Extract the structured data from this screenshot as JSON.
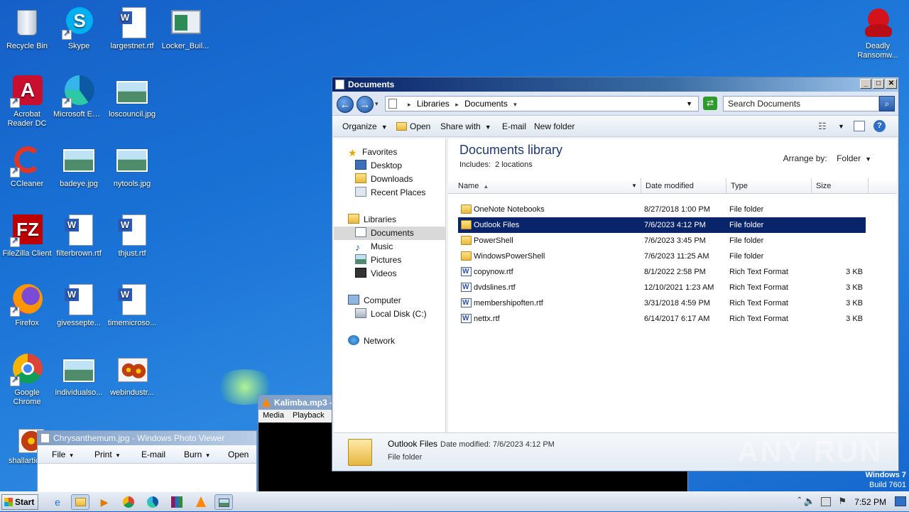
{
  "desktop": {
    "icons": [
      {
        "label": "Recycle Bin",
        "icon": "recycle-bin-icon"
      },
      {
        "label": "Skype",
        "icon": "skype-icon"
      },
      {
        "label": "largestnet.rtf",
        "icon": "rtf-document-icon"
      },
      {
        "label": "Locker_Buil...",
        "icon": "window-app-icon"
      },
      {
        "label": "Acrobat Reader DC",
        "icon": "acrobat-icon"
      },
      {
        "label": "Microsoft Edge",
        "icon": "edge-icon"
      },
      {
        "label": "loscouncil.jpg",
        "icon": "image-file-icon"
      },
      {
        "label": "CCleaner",
        "icon": "ccleaner-icon"
      },
      {
        "label": "badeye.jpg",
        "icon": "image-file-icon"
      },
      {
        "label": "nytools.jpg",
        "icon": "image-file-icon"
      },
      {
        "label": "FileZilla Client",
        "icon": "filezilla-icon"
      },
      {
        "label": "filterbrown.rtf",
        "icon": "rtf-document-icon"
      },
      {
        "label": "thjust.rtf",
        "icon": "rtf-document-icon"
      },
      {
        "label": "Firefox",
        "icon": "firefox-icon"
      },
      {
        "label": "givessepte...",
        "icon": "rtf-document-icon"
      },
      {
        "label": "timemicroso...",
        "icon": "rtf-document-icon"
      },
      {
        "label": "Google Chrome",
        "icon": "chrome-icon"
      },
      {
        "label": "individualso...",
        "icon": "image-file-icon"
      },
      {
        "label": "webindustr...",
        "icon": "flower-image-icon"
      },
      {
        "label": "shallarticle",
        "icon": "flower-image-icon"
      },
      {
        "label": "Deadly Ransomw...",
        "icon": "devil-icon"
      }
    ],
    "watermark": "Windows 7",
    "build": "Build 7601"
  },
  "explorer": {
    "title": "Documents",
    "breadcrumb": [
      "Libraries",
      "Documents"
    ],
    "search_placeholder": "Search Documents",
    "toolbar": {
      "organize": "Organize",
      "open": "Open",
      "share_with": "Share with",
      "email": "E-mail",
      "new_folder": "New folder"
    },
    "nav": {
      "favorites": "Favorites",
      "desktop": "Desktop",
      "downloads": "Downloads",
      "recent": "Recent Places",
      "libraries": "Libraries",
      "documents": "Documents",
      "music": "Music",
      "pictures": "Pictures",
      "videos": "Videos",
      "computer": "Computer",
      "local_disk": "Local Disk (C:)",
      "network": "Network"
    },
    "library_title": "Documents library",
    "includes_label": "Includes:",
    "includes_value": "2 locations",
    "arrange_label": "Arrange by:",
    "arrange_value": "Folder",
    "columns": {
      "name": "Name",
      "date": "Date modified",
      "type": "Type",
      "size": "Size"
    },
    "files": [
      {
        "name": "OneNote Notebooks",
        "date": "8/27/2018 1:00 PM",
        "type": "File folder",
        "size": "",
        "kind": "folder"
      },
      {
        "name": "Outlook Files",
        "date": "7/6/2023 4:12 PM",
        "type": "File folder",
        "size": "",
        "kind": "folder",
        "selected": true
      },
      {
        "name": "PowerShell",
        "date": "7/6/2023 3:45 PM",
        "type": "File folder",
        "size": "",
        "kind": "folder"
      },
      {
        "name": "WindowsPowerShell",
        "date": "7/6/2023 11:25 AM",
        "type": "File folder",
        "size": "",
        "kind": "folder"
      },
      {
        "name": "copynow.rtf",
        "date": "8/1/2022 2:58 PM",
        "type": "Rich Text Format",
        "size": "3 KB",
        "kind": "rtf"
      },
      {
        "name": "dvdslines.rtf",
        "date": "12/10/2021 1:23 AM",
        "type": "Rich Text Format",
        "size": "3 KB",
        "kind": "rtf"
      },
      {
        "name": "membershipoften.rtf",
        "date": "3/31/2018 4:59 PM",
        "type": "Rich Text Format",
        "size": "3 KB",
        "kind": "rtf"
      },
      {
        "name": "nettx.rtf",
        "date": "6/14/2017 6:17 AM",
        "type": "Rich Text Format",
        "size": "3 KB",
        "kind": "rtf"
      }
    ],
    "details": {
      "name": "Outlook Files",
      "date_label": "Date modified:",
      "date_value": "7/6/2023 4:12 PM",
      "type": "File folder"
    }
  },
  "photo_viewer": {
    "title": "Chrysanthemum.jpg - Windows Photo Viewer",
    "menu": [
      "File",
      "Print",
      "E-mail",
      "Burn",
      "Open"
    ]
  },
  "vlc": {
    "title": "Kalimba.mp3 -",
    "menu": [
      "Media",
      "Playback"
    ]
  },
  "watermark_brand": "ANY RUN",
  "taskbar": {
    "start": "Start",
    "clock": "7:52 PM"
  },
  "colors": {
    "selection": "#0a246a",
    "title_gradient_start": "#0a246a",
    "desktop_blue": "#1a73d6"
  }
}
